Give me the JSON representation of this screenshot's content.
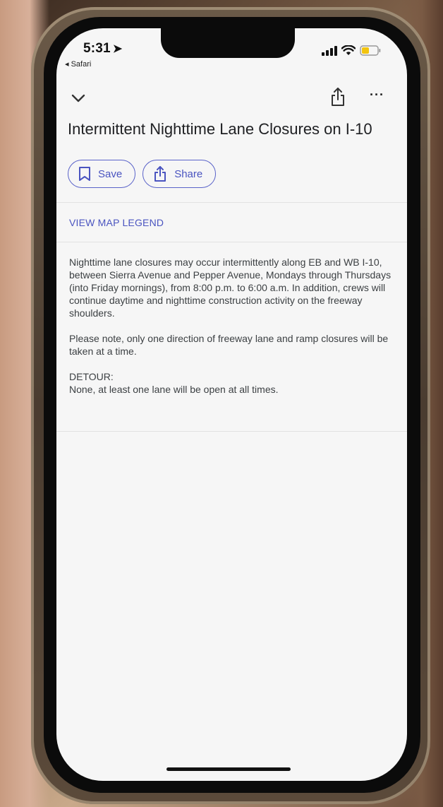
{
  "status_bar": {
    "time": "5:31",
    "back_app": "◂ Safari"
  },
  "toolbar": {
    "collapse_icon": "chevron-down-icon",
    "share_icon": "share-icon",
    "more_icon": "more-horizontal-icon",
    "more_glyph": "···"
  },
  "place": {
    "title": "Intermittent Nighttime Lane Closures on I-10"
  },
  "actions": {
    "save_label": "Save",
    "share_label": "Share"
  },
  "legend": {
    "link_label": "VIEW MAP LEGEND"
  },
  "description": {
    "paragraph_1": "Nighttime lane closures may occur intermittently along EB and WB I-10, between Sierra Avenue and Pepper Avenue, Mondays through Thursdays (into Friday mornings), from 8:00 p.m. to 6:00 a.m.  In addition, crews will continue daytime and nighttime construction activity on the freeway shoulders.",
    "paragraph_2": "Please note, only one direction of freeway lane and ramp closures will be taken at a time.",
    "paragraph_3_heading": "DETOUR:",
    "paragraph_3_body": "None, at least one lane will be open at all times."
  },
  "colors": {
    "accent": "#4a54c0",
    "text": "#202124",
    "body_text": "#3c4043",
    "battery": "#f2c40f"
  }
}
